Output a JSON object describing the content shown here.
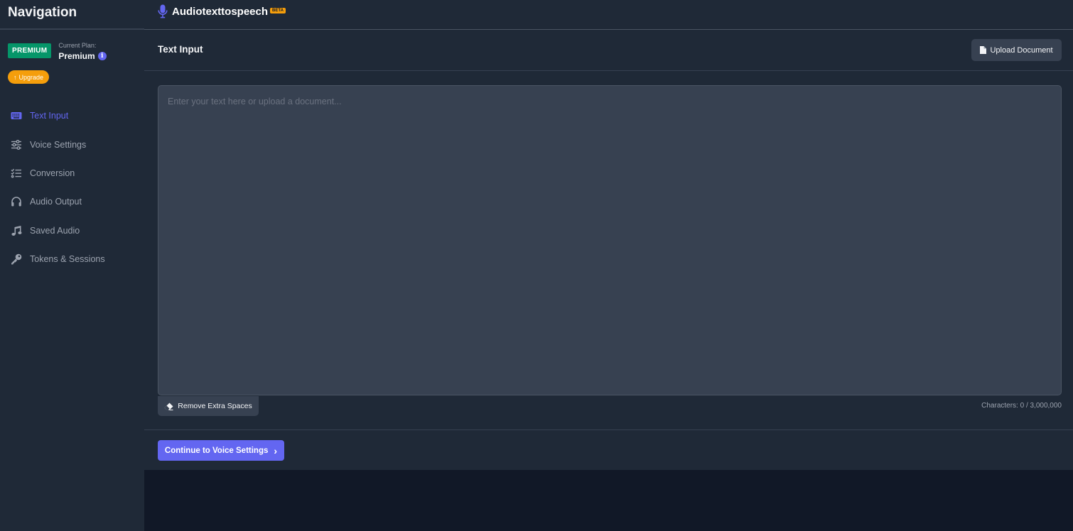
{
  "sidebar": {
    "title": "Navigation",
    "plan_badge": "PREMIUM",
    "plan_label": "Current Plan:",
    "plan_value": "Premium",
    "info_glyph": "i",
    "upgrade_label": "Upgrade",
    "items": [
      {
        "label": "Text Input",
        "icon": "keyboard-icon",
        "active": true
      },
      {
        "label": "Voice Settings",
        "icon": "sliders-icon",
        "active": false
      },
      {
        "label": "Conversion",
        "icon": "tasks-icon",
        "active": false
      },
      {
        "label": "Audio Output",
        "icon": "headphones-icon",
        "active": false
      },
      {
        "label": "Saved Audio",
        "icon": "music-note-icon",
        "active": false
      },
      {
        "label": "Tokens & Sessions",
        "icon": "key-icon",
        "active": false
      }
    ]
  },
  "header": {
    "brand": "Audiotexttospeech",
    "beta": "BETA"
  },
  "main": {
    "title": "Text Input",
    "upload_label": "Upload Document",
    "text_value": "",
    "placeholder": "Enter your text here or upload a document...",
    "remove_label": "Remove Extra Spaces",
    "char_count": "Characters: 0 / 3,000,000",
    "continue_label": "Continue to Voice Settings"
  },
  "colors": {
    "accent": "#6366f1",
    "premium": "#059669",
    "upgrade": "#f59e0b",
    "sidebar_bg": "#1f2937",
    "page_bg": "#111827"
  }
}
